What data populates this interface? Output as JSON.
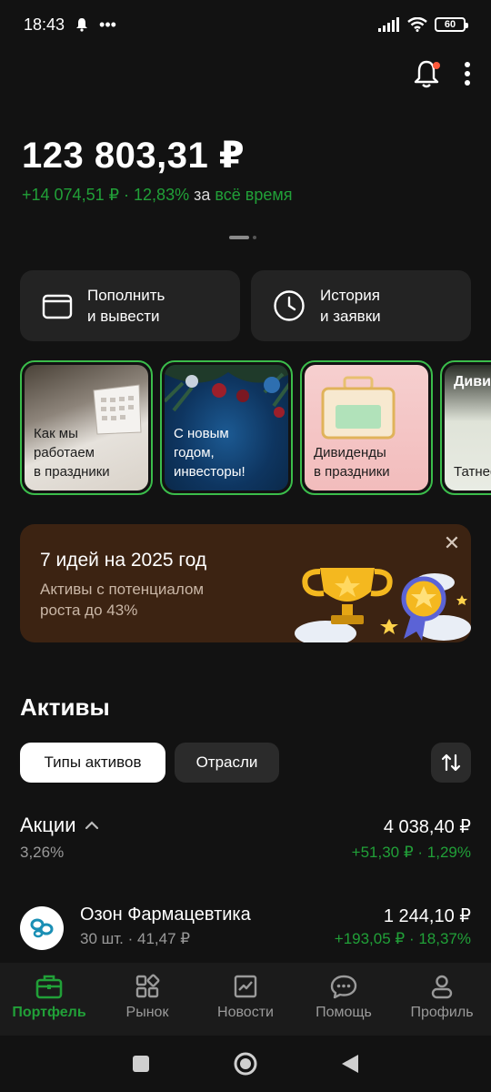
{
  "status_bar": {
    "time": "18:43",
    "dots": "•••",
    "battery": "60",
    "icons": [
      "notification-bell-icon",
      "signal-icon",
      "wifi-icon",
      "battery-icon"
    ]
  },
  "header": {
    "icons": [
      "bell-icon",
      "more-vertical-icon"
    ],
    "has_notification": true
  },
  "portfolio": {
    "balance": "123 803,31 ₽",
    "change_value": "+14 074,51 ₽ · 12,83%",
    "change_word": "за",
    "change_period": "всё время"
  },
  "actions": [
    {
      "label": "Пополнить\nи вывести",
      "icon": "wallet-icon"
    },
    {
      "label": "История\nи заявки",
      "icon": "clock-icon"
    }
  ],
  "stories": [
    {
      "text": "Как мы\nработаем\nв праздники",
      "color": "#c9c3bc"
    },
    {
      "text": "С новым\nгодом,\nинвесторы!",
      "color": "#0f3a66"
    },
    {
      "text": "Дивиденды\nв праздники",
      "color": "#f2c2c2"
    },
    {
      "text": "Татнеф",
      "header": "Диви",
      "color": "#d8dcd0"
    }
  ],
  "promo": {
    "title": "7 идей на 2025 год",
    "subtitle": "Активы с потенциалом\nроста до 43%",
    "close": "✕",
    "background": "#3c2312"
  },
  "assets": {
    "title": "Активы",
    "filters": [
      "Типы активов",
      "Отрасли"
    ],
    "group": {
      "title": "Акции",
      "share": "3,26%",
      "value": "4 038,40 ₽",
      "change": "+51,30 ₽ · 1,29%"
    },
    "items": [
      {
        "name": "Озон Фармацевтика",
        "qty": "30 шт. · 41,47 ₽",
        "value": "1 244,10 ₽",
        "change": "+193,05 ₽ · 18,37%"
      }
    ]
  },
  "bottom_nav": [
    {
      "label": "Портфель",
      "icon": "briefcase-icon",
      "active": true
    },
    {
      "label": "Рынок",
      "icon": "market-grid-icon",
      "active": false
    },
    {
      "label": "Новости",
      "icon": "news-chart-icon",
      "active": false
    },
    {
      "label": "Помощь",
      "icon": "chat-help-icon",
      "active": false
    },
    {
      "label": "Профиль",
      "icon": "profile-icon",
      "active": false
    }
  ],
  "colors": {
    "accent_green": "#21a038",
    "background": "#121212",
    "card": "#232323"
  }
}
